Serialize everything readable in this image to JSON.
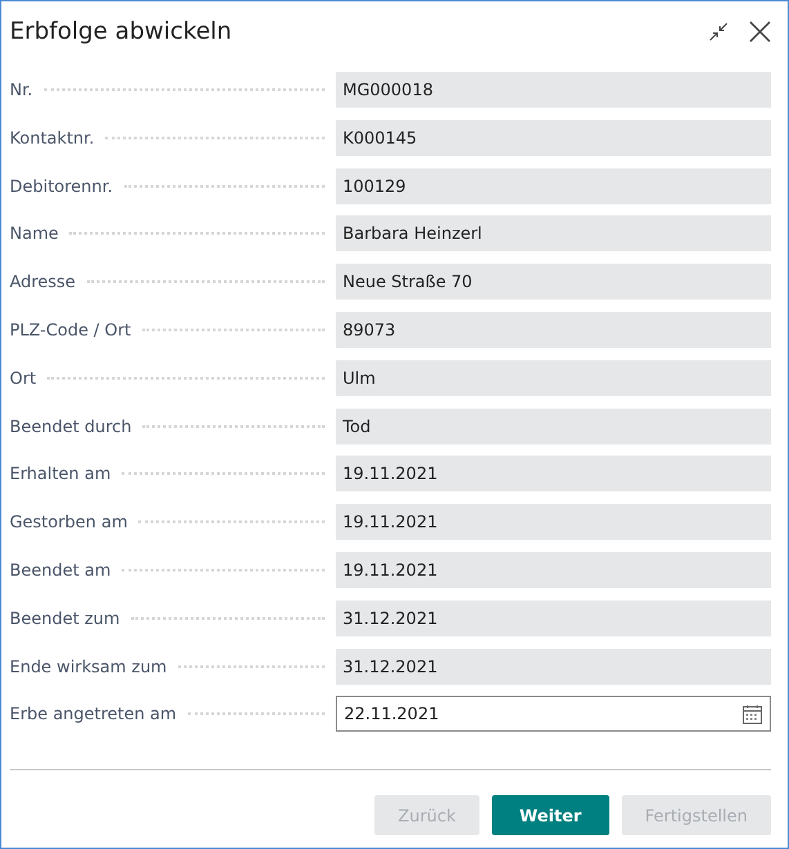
{
  "window": {
    "title": "Erbfolge abwickeln"
  },
  "fields": [
    {
      "label": "Nr.",
      "value": "MG000018",
      "kind": "readonly"
    },
    {
      "label": "Kontaktnr.",
      "value": "K000145",
      "kind": "readonly"
    },
    {
      "label": "Debitorennr.",
      "value": "100129",
      "kind": "readonly"
    },
    {
      "label": "Name",
      "value": "Barbara Heinzerl",
      "kind": "readonly"
    },
    {
      "label": "Adresse",
      "value": "Neue Straße 70",
      "kind": "readonly"
    },
    {
      "label": "PLZ-Code / Ort",
      "value": "89073",
      "kind": "readonly"
    },
    {
      "label": "Ort",
      "value": "Ulm",
      "kind": "readonly"
    },
    {
      "label": "Beendet durch",
      "value": "Tod",
      "kind": "readonly"
    },
    {
      "label": "Erhalten am",
      "value": "19.11.2021",
      "kind": "readonly"
    },
    {
      "label": "Gestorben am",
      "value": "19.11.2021",
      "kind": "readonly"
    },
    {
      "label": "Beendet am",
      "value": "19.11.2021",
      "kind": "readonly"
    },
    {
      "label": "Beendet zum",
      "value": "31.12.2021",
      "kind": "readonly"
    },
    {
      "label": "Ende wirksam zum",
      "value": "31.12.2021",
      "kind": "readonly"
    },
    {
      "label": "Erbe angetreten am",
      "value": "22.11.2021",
      "kind": "date"
    }
  ],
  "buttons": [
    {
      "label": "Zurück",
      "disabled": true,
      "primary": false
    },
    {
      "label": "Weiter",
      "disabled": false,
      "primary": true
    },
    {
      "label": "Fertigstellen",
      "disabled": true,
      "primary": false
    }
  ]
}
